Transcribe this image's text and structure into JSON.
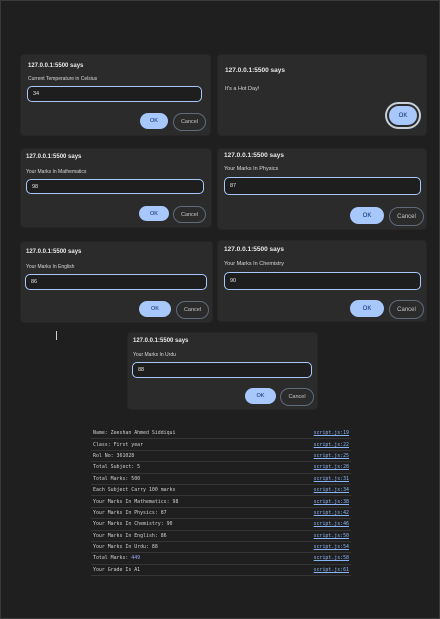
{
  "dialog_title": "127.0.0.1:5500 says",
  "ok_label": "OK",
  "cancel_label": "Cancel",
  "dialogs": [
    {
      "message": "Current Temperature in Celsius",
      "value": "34"
    },
    {
      "message": "It's a Hot Day!"
    },
    {
      "message": "Your Marks In Mathematics",
      "value": "98"
    },
    {
      "message": "Your Marks In Physics",
      "value": "87"
    },
    {
      "message": "Your Marks In English",
      "value": "86"
    },
    {
      "message": "Your Marks In Chemistry",
      "value": "90"
    },
    {
      "message": "Your Marks In Urdu",
      "value": "88"
    }
  ],
  "console": [
    {
      "text": "Name: Zeeshan Ahmed Siddiqui",
      "source": "script.js:19"
    },
    {
      "text": "Class: First year",
      "source": "script.js:22"
    },
    {
      "text": "Rol No: 361028",
      "source": "script.js:25"
    },
    {
      "text": "Total Subject: 5",
      "source": "script.js:28"
    },
    {
      "text": "Total Marks: 500",
      "source": "script.js:31"
    },
    {
      "text": "Each Subject Carry 100 marks",
      "source": "script.js:34"
    },
    {
      "text": "Your Marks In Mathematics: 98",
      "source": "script.js:38"
    },
    {
      "text": "Your Marks In Physics: 87",
      "source": "script.js:42"
    },
    {
      "text": "Your Marks In Chemistry: 90",
      "source": "script.js:46"
    },
    {
      "text": "Your Marks In English: 86",
      "source": "script.js:50"
    },
    {
      "text": "Your Marks In Urdu: 88",
      "source": "script.js:54"
    },
    {
      "text": "Total Marks: ",
      "number": "449",
      "source": "script.js:58"
    },
    {
      "text": "Your Grade Is A1",
      "source": "script.js:61"
    }
  ]
}
